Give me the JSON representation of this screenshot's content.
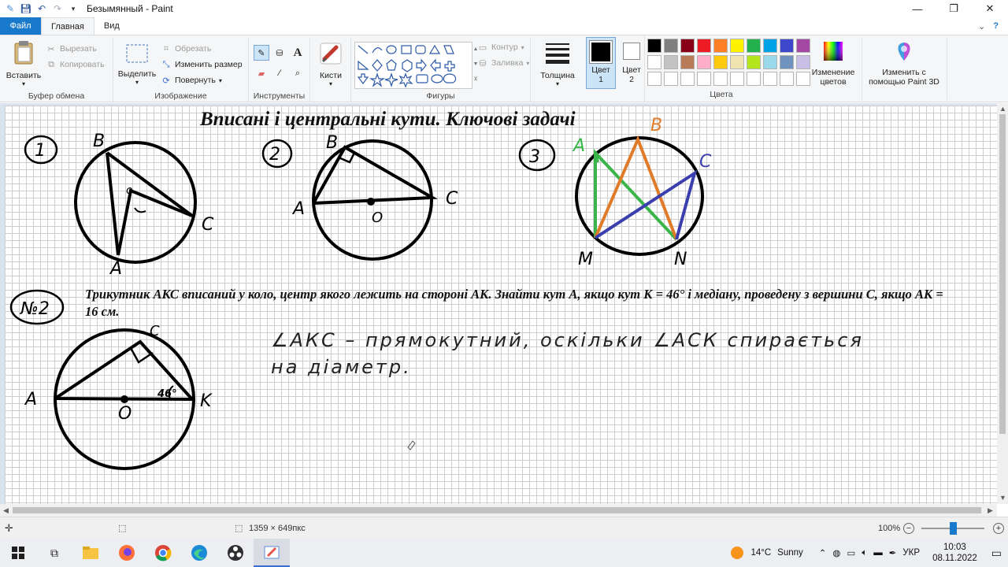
{
  "window": {
    "title": "Безымянный - Paint"
  },
  "menu": {
    "file": "Файл",
    "tabs": [
      "Главная",
      "Вид"
    ]
  },
  "ribbon": {
    "clipboard": {
      "label": "Буфер обмена",
      "paste": "Вставить",
      "cut": "Вырезать",
      "copy": "Копировать"
    },
    "image": {
      "label": "Изображение",
      "select": "Выделить",
      "crop": "Обрезать",
      "resize": "Изменить размер",
      "rotate": "Повернуть"
    },
    "tools": {
      "label": "Инструменты"
    },
    "brushes": {
      "label": "Кисти"
    },
    "shapes": {
      "label": "Фигуры",
      "outline": "Контур",
      "fill": "Заливка"
    },
    "size": {
      "label": "Толщина"
    },
    "color1": {
      "label": "Цвет",
      "num": "1"
    },
    "color2": {
      "label": "Цвет",
      "num": "2"
    },
    "colors": {
      "label": "Цвета"
    },
    "edit_colors": {
      "label": "Изменение цветов"
    },
    "paint3d": {
      "label": "Изменить с помощью Paint 3D"
    },
    "palette": [
      "#000000",
      "#7f7f7f",
      "#880015",
      "#ed1c24",
      "#ff7f27",
      "#fff200",
      "#22b14c",
      "#00a2e8",
      "#3f48cc",
      "#a349a4",
      "#ffffff",
      "#c3c3c3",
      "#b97a57",
      "#ffaec9",
      "#ffc90e",
      "#efe4b0",
      "#b5e61d",
      "#99d9ea",
      "#7092be",
      "#c8bfe7",
      "#ffffff",
      "#ffffff",
      "#ffffff",
      "#ffffff",
      "#ffffff",
      "#ffffff",
      "#ffffff",
      "#ffffff",
      "#ffffff",
      "#ffffff"
    ]
  },
  "drawing": {
    "heading": "Вписані і центральні кути. Ключові задачі",
    "task": "Трикутник АКС вписаний у коло, центр якого лежить на стороні АК. Знайти кут А, якщо кут К = 46° і медіану, проведену з вершини С, якщо АК = 16 см.",
    "handwriting_line1": "∠АКС – прямокутний, оскільки ∠АСК спирається",
    "handwriting_line2": "на діаметр.",
    "labels": {
      "fig1": "1",
      "fig2": "2",
      "fig3": "3",
      "task_num": "№2",
      "f1_B": "B",
      "f1_C": "C",
      "f1_A": "A",
      "f1_O": "o",
      "f2_B": "B",
      "f2_A": "A",
      "f2_C": "C",
      "f2_O": "O",
      "f3_A": "A",
      "f3_B": "B",
      "f3_C": "C",
      "f3_M": "M",
      "f3_N": "N",
      "t_A": "A",
      "t_C": "C",
      "t_K": "K",
      "t_O": "O",
      "t_angle": "46°"
    }
  },
  "status": {
    "image_size": "1359 × 649пкс",
    "zoom": "100%"
  },
  "taskbar": {
    "weather_temp": "14°C",
    "weather_text": "Sunny",
    "lang": "УКР",
    "time": "10:03",
    "date": "08.11.2022"
  }
}
